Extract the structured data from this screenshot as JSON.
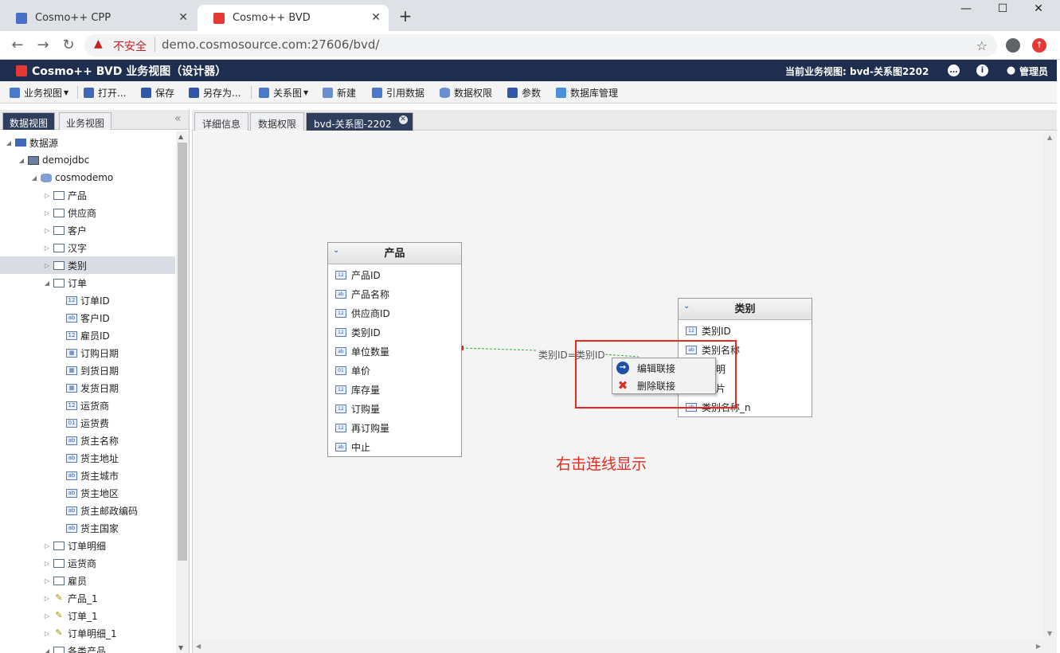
{
  "browser": {
    "tabs": [
      {
        "title": "Cosmo++ CPP",
        "active": false
      },
      {
        "title": "Cosmo++ BVD",
        "active": true
      }
    ],
    "new_tab": "+",
    "security_label": "不安全",
    "url": "demo.cosmosource.com:27606/bvd/",
    "window_controls": {
      "minimize": "—",
      "maximize": "☐",
      "close": "✕"
    }
  },
  "app": {
    "title": "Cosmo++ BVD 业务视图（设计器）",
    "current_view": "当前业务视图: bvd-关系图2202",
    "user": "管理员",
    "accent": "#1f2d4e"
  },
  "toolbar": {
    "business_view": "业务视图",
    "open": "打开...",
    "save": "保存",
    "save_as": "另存为...",
    "relation_diagram": "关系图",
    "new": "新建",
    "reference_data": "引用数据",
    "data_permission": "数据权限",
    "params": "参数",
    "db_management": "数据库管理"
  },
  "left_panel": {
    "tabs": [
      "数据视图",
      "业务视图"
    ],
    "collapse_glyph": "«",
    "tree": [
      {
        "label": "数据源",
        "depth": 0,
        "icon": "folder",
        "toggle": "expanded"
      },
      {
        "label": "demojdbc",
        "depth": 1,
        "icon": "server",
        "toggle": "expanded"
      },
      {
        "label": "cosmodemo",
        "depth": 2,
        "icon": "db",
        "toggle": "expanded"
      },
      {
        "label": "产品",
        "depth": 3,
        "icon": "table",
        "toggle": "collapsed"
      },
      {
        "label": "供应商",
        "depth": 3,
        "icon": "table",
        "toggle": "collapsed"
      },
      {
        "label": "客户",
        "depth": 3,
        "icon": "table",
        "toggle": "collapsed"
      },
      {
        "label": "汉字",
        "depth": 3,
        "icon": "table",
        "toggle": "collapsed"
      },
      {
        "label": "类别",
        "depth": 3,
        "icon": "table",
        "toggle": "collapsed",
        "selected": true
      },
      {
        "label": "订单",
        "depth": 3,
        "icon": "table",
        "toggle": "expanded"
      },
      {
        "label": "订单ID",
        "depth": 4,
        "icon": "12"
      },
      {
        "label": "客户ID",
        "depth": 4,
        "icon": "ab"
      },
      {
        "label": "雇员ID",
        "depth": 4,
        "icon": "12"
      },
      {
        "label": "订购日期",
        "depth": 4,
        "icon": "date"
      },
      {
        "label": "到货日期",
        "depth": 4,
        "icon": "date"
      },
      {
        "label": "发货日期",
        "depth": 4,
        "icon": "date"
      },
      {
        "label": "运货商",
        "depth": 4,
        "icon": "12"
      },
      {
        "label": "运货费",
        "depth": 4,
        "icon": "01"
      },
      {
        "label": "货主名称",
        "depth": 4,
        "icon": "ab"
      },
      {
        "label": "货主地址",
        "depth": 4,
        "icon": "ab"
      },
      {
        "label": "货主城市",
        "depth": 4,
        "icon": "ab"
      },
      {
        "label": "货主地区",
        "depth": 4,
        "icon": "ab"
      },
      {
        "label": "货主邮政编码",
        "depth": 4,
        "icon": "ab"
      },
      {
        "label": "货主国家",
        "depth": 4,
        "icon": "ab"
      },
      {
        "label": "订单明细",
        "depth": 3,
        "icon": "table",
        "toggle": "collapsed"
      },
      {
        "label": "运货商",
        "depth": 3,
        "icon": "table",
        "toggle": "collapsed"
      },
      {
        "label": "雇员",
        "depth": 3,
        "icon": "table",
        "toggle": "collapsed"
      },
      {
        "label": "产品_1",
        "depth": 3,
        "icon": "pencil",
        "toggle": "collapsed"
      },
      {
        "label": "订单_1",
        "depth": 3,
        "icon": "pencil",
        "toggle": "collapsed"
      },
      {
        "label": "订单明细_1",
        "depth": 3,
        "icon": "pencil",
        "toggle": "collapsed"
      },
      {
        "label": "各类产品",
        "depth": 3,
        "icon": "table",
        "toggle": "expanded"
      }
    ]
  },
  "canvas_tabs": [
    "详细信息",
    "数据权限",
    "bvd-关系图-2202"
  ],
  "canvas_tab_close": "✕",
  "entities": {
    "product": {
      "title": "产品",
      "fields": [
        {
          "name": "产品ID",
          "type": "12"
        },
        {
          "name": "产品名称",
          "type": "ab"
        },
        {
          "name": "供应商ID",
          "type": "12"
        },
        {
          "name": "类别ID",
          "type": "12"
        },
        {
          "name": "单位数量",
          "type": "ab"
        },
        {
          "name": "单价",
          "type": "01"
        },
        {
          "name": "库存量",
          "type": "12"
        },
        {
          "name": "订购量",
          "type": "12"
        },
        {
          "name": "再订购量",
          "type": "12"
        },
        {
          "name": "中止",
          "type": "ab"
        }
      ]
    },
    "category": {
      "title": "类别",
      "fields": [
        {
          "name": "类别ID",
          "type": "12"
        },
        {
          "name": "类别名称",
          "type": "ab"
        },
        {
          "name": "说明",
          "type": "ab",
          "partial": "明"
        },
        {
          "name": "图片",
          "type": "ab",
          "partial": "片"
        },
        {
          "name": "类别名称_n",
          "type": "ab"
        }
      ]
    }
  },
  "link_label": "类别ID=类别ID",
  "context_menu": {
    "edit_link": "编辑联接",
    "delete_link": "删除联接"
  },
  "annotation": "右击连线显示",
  "annotation_color": "#e8291c"
}
